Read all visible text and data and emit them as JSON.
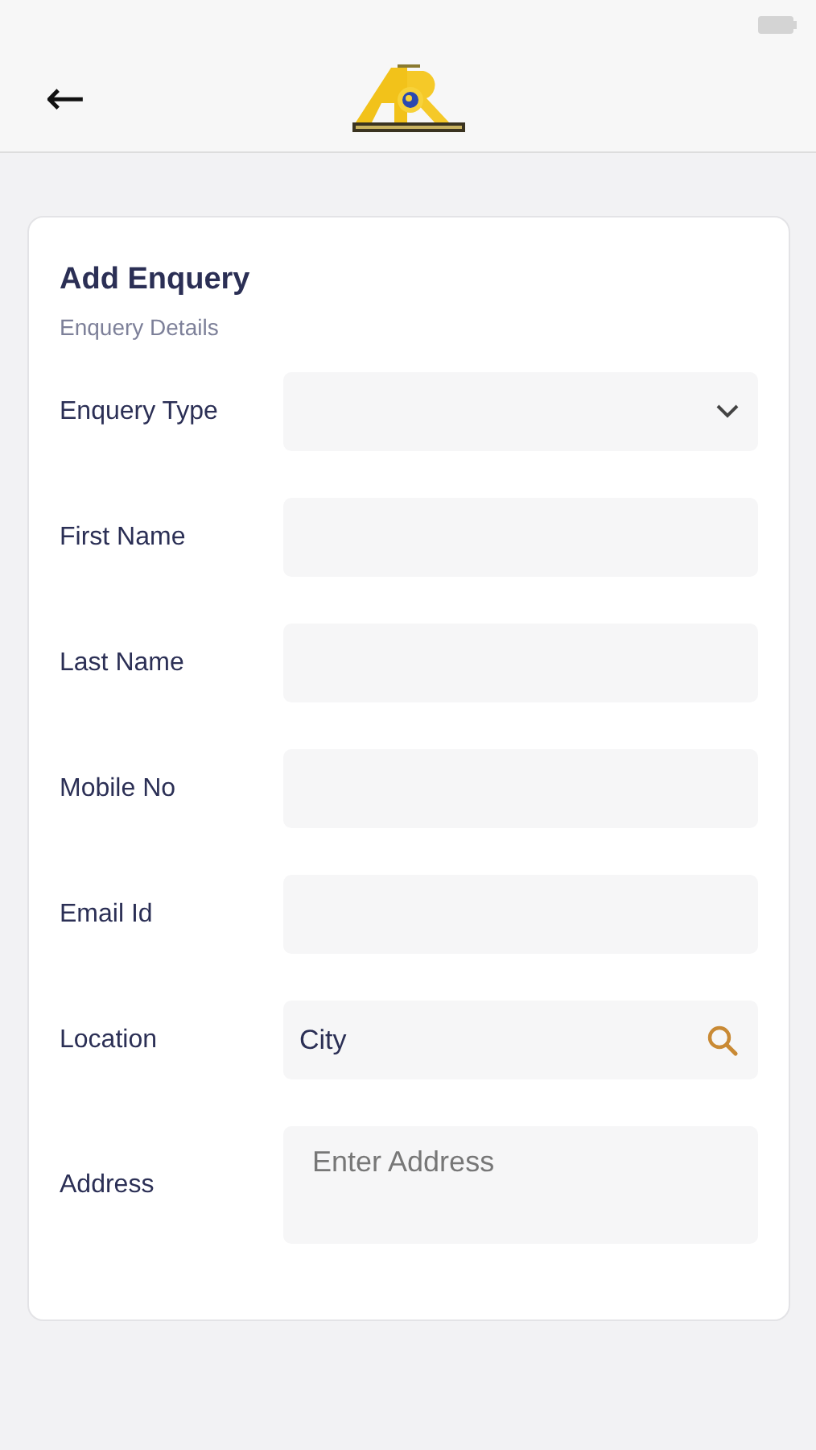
{
  "header": {
    "back": "←"
  },
  "form": {
    "title": "Add Enquery",
    "subtitle": "Enquery Details",
    "fields": [
      {
        "label": "Enquery Type",
        "kind": "select"
      },
      {
        "label": "First Name",
        "kind": "text"
      },
      {
        "label": "Last Name",
        "kind": "text"
      },
      {
        "label": "Mobile No",
        "kind": "text"
      },
      {
        "label": "Email Id",
        "kind": "text"
      },
      {
        "label": "Location",
        "kind": "search",
        "value": "City"
      },
      {
        "label": "Address",
        "kind": "textarea",
        "placeholder": "Enter Address"
      }
    ]
  }
}
